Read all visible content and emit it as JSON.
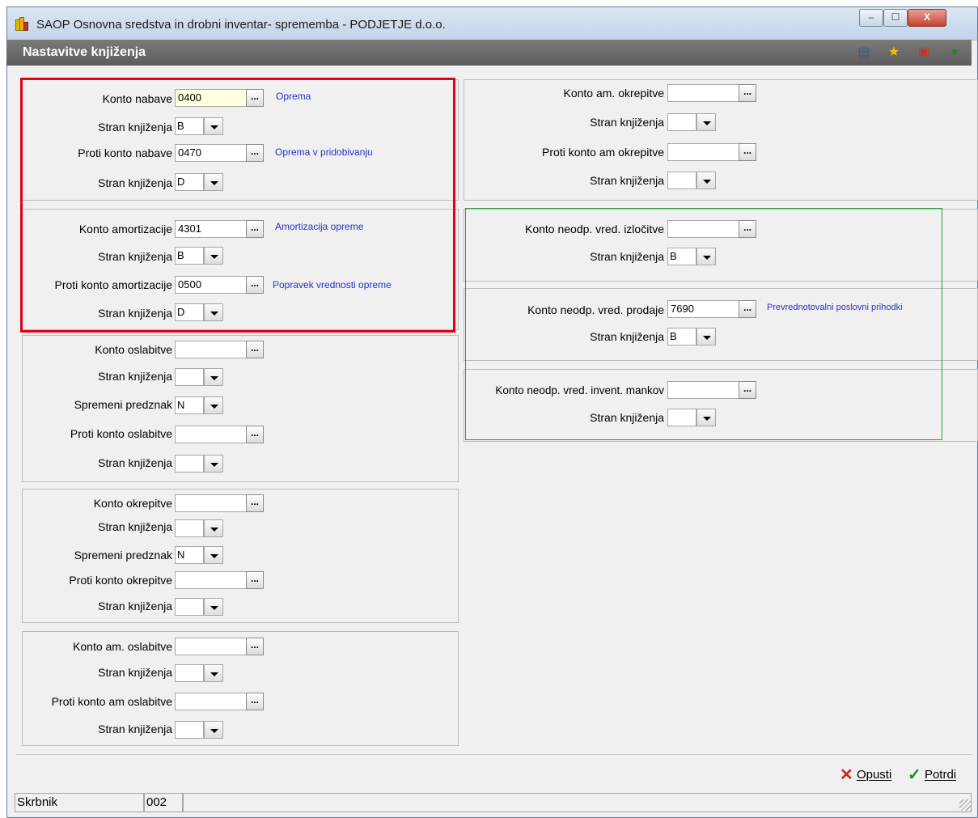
{
  "window": {
    "title": "SAOP Osnovna sredstva in drobni inventar- sprememba - PODJETJE d.o.o.",
    "minimize": "‒",
    "maximize": "☐",
    "close": "X"
  },
  "header": {
    "title": "Nastavitve knjiženja"
  },
  "dots": "...",
  "left": {
    "nabava": {
      "konto_label": "Konto nabave",
      "konto_value": "0400",
      "konto_desc": "Oprema",
      "stran1_label": "Stran knjiženja",
      "stran1_value": "B",
      "proti_label": "Proti konto nabave",
      "proti_value": "0470",
      "proti_desc": "Oprema v pridobivanju",
      "stran2_label": "Stran knjiženja",
      "stran2_value": "D"
    },
    "amortizacija": {
      "konto_label": "Konto amortizacije",
      "konto_value": "4301",
      "konto_desc": "Amortizacija opreme",
      "stran1_label": "Stran knjiženja",
      "stran1_value": "B",
      "proti_label": "Proti konto amortizacije",
      "proti_value": "0500",
      "proti_desc": "Popravek vrednosti opreme",
      "stran2_label": "Stran knjiženja",
      "stran2_value": "D"
    },
    "oslabitev": {
      "konto_label": "Konto oslabitve",
      "konto_value": "",
      "stran1_label": "Stran knjiženja",
      "stran1_value": "",
      "predznak_label": "Spremeni predznak",
      "predznak_value": "N",
      "proti_label": "Proti konto oslabitve",
      "proti_value": "",
      "stran2_label": "Stran knjiženja",
      "stran2_value": ""
    },
    "okrepitev": {
      "konto_label": "Konto okrepitve",
      "konto_value": "",
      "stran1_label": "Stran knjiženja",
      "stran1_value": "",
      "predznak_label": "Spremeni predznak",
      "predznak_value": "N",
      "proti_label": "Proti konto okrepitve",
      "proti_value": "",
      "stran2_label": "Stran knjiženja",
      "stran2_value": ""
    },
    "am_oslabitev": {
      "konto_label": "Konto am. oslabitve",
      "konto_value": "",
      "stran1_label": "Stran knjiženja",
      "stran1_value": "",
      "proti_label": "Proti konto am oslabitve",
      "proti_value": "",
      "stran2_label": "Stran knjiženja",
      "stran2_value": ""
    }
  },
  "right": {
    "am_okrepitev": {
      "konto_label": "Konto am. okrepitve",
      "konto_value": "",
      "stran1_label": "Stran knjiženja",
      "stran1_value": "",
      "proti_label": "Proti konto am okrepitve",
      "proti_value": "",
      "stran2_label": "Stran knjiženja",
      "stran2_value": ""
    },
    "izlocitev": {
      "konto_label": "Konto neodp. vred. izločitve",
      "konto_value": "",
      "stran_label": "Stran knjiženja",
      "stran_value": "B"
    },
    "prodaja": {
      "konto_label": "Konto neodp. vred. prodaje",
      "konto_value": "7690",
      "konto_desc": "Prevrednotovalni poslovni prihodki",
      "stran_label": "Stran knjiženja",
      "stran_value": "B"
    },
    "manki": {
      "konto_label": "Konto neodp. vred. invent. mankov",
      "konto_value": "",
      "stran_label": "Stran knjiženja",
      "stran_value": ""
    }
  },
  "actions": {
    "cancel": "Opusti",
    "confirm": "Potrdi"
  },
  "status": {
    "label": "Skrbnik",
    "code": "002"
  },
  "colors": {
    "highlight_red": "#e0001b",
    "highlight_green": "#2f9a3c",
    "desc_blue": "#2233cc",
    "header_gray": "#6b6b6b"
  }
}
